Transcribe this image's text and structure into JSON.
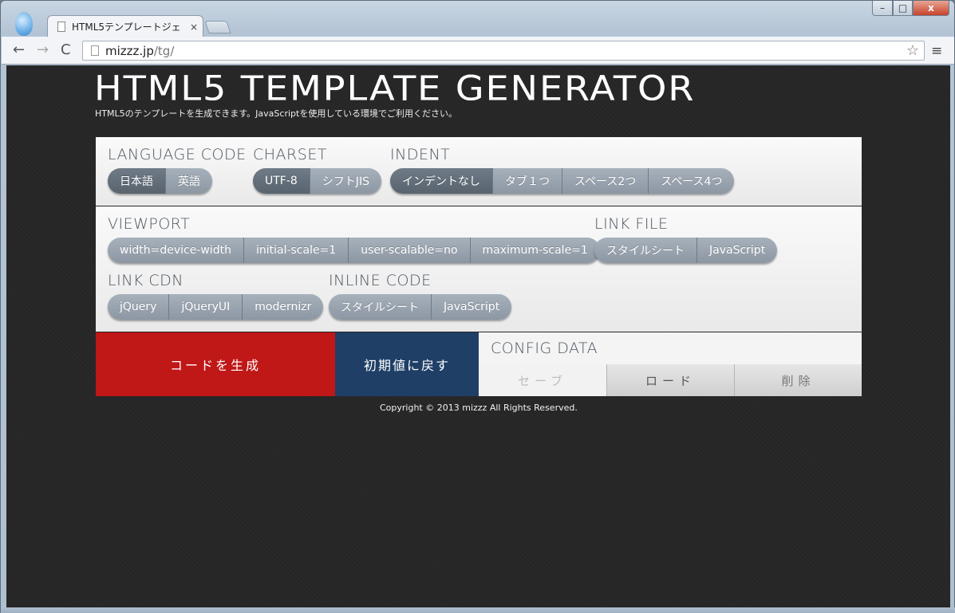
{
  "browser": {
    "tab_title": "HTML5テンプレートジェ",
    "tab_close": "×",
    "url_host": "mizzz.jp",
    "url_path": "/tg/",
    "nav_back": "←",
    "nav_forward": "→",
    "nav_reload": "C",
    "star": "☆",
    "menu": "≡",
    "win_min": "–",
    "win_max": "□",
    "win_close": "x"
  },
  "page": {
    "title": "HTML5 TEMPLATE GENERATOR",
    "subtitle": "HTML5のテンプレートを生成できます。JavaScriptを使用している環境でご利用ください。",
    "copyright": "Copyright © 2013 mizzz All Rights Reserved."
  },
  "language": {
    "label": "LANGUAGE CODE",
    "options": [
      "日本語",
      "英語"
    ],
    "selected": "日本語"
  },
  "charset": {
    "label": "CHARSET",
    "options": [
      "UTF-8",
      "シフトJIS"
    ],
    "selected": "UTF-8"
  },
  "indent": {
    "label": "INDENT",
    "options": [
      "インデントなし",
      "タブ１つ",
      "スペース2つ",
      "スペース4つ"
    ],
    "selected": "インデントなし"
  },
  "viewport": {
    "label": "VIEWPORT",
    "options": [
      "width=device-width",
      "initial-scale=1",
      "user-scalable=no",
      "maximum-scale=1"
    ]
  },
  "link_file": {
    "label": "LINK FILE",
    "options": [
      "スタイルシート",
      "JavaScript"
    ]
  },
  "link_cdn": {
    "label": "LINK CDN",
    "options": [
      "jQuery",
      "jQueryUI",
      "modernizr"
    ]
  },
  "inline_code": {
    "label": "INLINE CODE",
    "options": [
      "スタイルシート",
      "JavaScript"
    ]
  },
  "actions": {
    "generate": "コードを生成",
    "reset": "初期値に戻す"
  },
  "config": {
    "label": "CONFIG DATA",
    "save": "セーブ",
    "load": "ロード",
    "delete": "削除"
  },
  "colors": {
    "generate_bg": "#c01717",
    "reset_bg": "#1f3f66",
    "selected_btn": "#5e6974",
    "btn": "#9aa4af"
  }
}
